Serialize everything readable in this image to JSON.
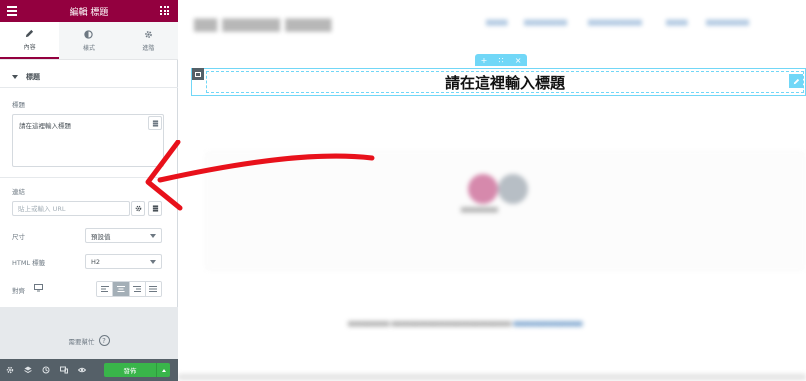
{
  "editor": {
    "header_title": "編輯 標題",
    "tabs": [
      {
        "label": "內容",
        "icon": "pencil-icon",
        "active": true
      },
      {
        "label": "樣式",
        "icon": "half-circle-icon",
        "active": false
      },
      {
        "label": "進階",
        "icon": "gear-icon",
        "active": false
      }
    ],
    "section_title": "標題",
    "title_label": "標題",
    "title_value": "請在這裡輸入標題",
    "link_label": "連結",
    "link_placeholder": "貼上或輸入 URL",
    "size_label": "尺寸",
    "size_value": "預設值",
    "html_tag_label": "HTML 標籤",
    "html_tag_value": "H2",
    "alignment_label": "對齊",
    "alignment_active": "center",
    "help_label": "需要幫忙",
    "publish_label": "發佈"
  },
  "canvas": {
    "heading_text": "請在這裡輸入標題"
  },
  "colors": {
    "brand": "#93003f",
    "accent": "#71d7f7",
    "publish": "#39b54a",
    "arrow": "#e8111b"
  }
}
